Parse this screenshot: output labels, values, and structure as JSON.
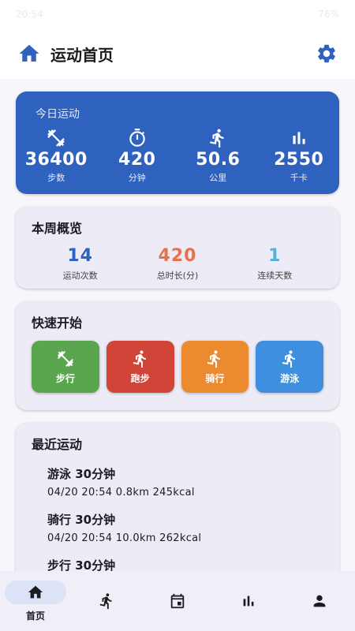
{
  "status_bar": {
    "time": "20:54",
    "battery": "76%"
  },
  "app_bar": {
    "title": "运动首页",
    "home_icon": "home-icon",
    "settings_icon": "gear-icon"
  },
  "today": {
    "label": "今日运动",
    "stats": [
      {
        "icon": "dumbbell-icon",
        "value": "36400",
        "unit": "步数"
      },
      {
        "icon": "timer-icon",
        "value": "420",
        "unit": "分钟"
      },
      {
        "icon": "run-icon",
        "value": "50.6",
        "unit": "公里"
      },
      {
        "icon": "bar-chart-icon",
        "value": "2550",
        "unit": "千卡"
      }
    ],
    "color": "#2f62bf"
  },
  "week": {
    "title": "本周概览",
    "stats": [
      {
        "value": "14",
        "caption": "运动次数",
        "color": "#2f62bf"
      },
      {
        "value": "420",
        "caption": "总时长(分)",
        "color": "#e7714c"
      },
      {
        "value": "1",
        "caption": "连续天数",
        "color": "#4fb5d8"
      }
    ]
  },
  "quick": {
    "title": "快速开始",
    "buttons": [
      {
        "label": "步行",
        "icon": "dumbbell-icon",
        "color": "#5aa64f"
      },
      {
        "label": "跑步",
        "icon": "run-icon",
        "color": "#d14438"
      },
      {
        "label": "骑行",
        "icon": "run-icon",
        "color": "#ec8a30"
      },
      {
        "label": "游泳",
        "icon": "run-icon",
        "color": "#3f8fe0"
      }
    ]
  },
  "recent": {
    "title": "最近运动",
    "items": [
      {
        "title": "游泳  30分钟",
        "detail": "04/20 20:54  0.8km  245kcal"
      },
      {
        "title": "骑行  30分钟",
        "detail": "04/20 20:54  10.0km  262kcal"
      },
      {
        "title": "步行  30分钟",
        "detail": ""
      }
    ]
  },
  "nav": {
    "items": [
      {
        "label": "首页",
        "icon": "home-icon",
        "active": true
      },
      {
        "label": "",
        "icon": "run-icon"
      },
      {
        "label": "",
        "icon": "calendar-icon"
      },
      {
        "label": "",
        "icon": "bar-chart-icon"
      },
      {
        "label": "",
        "icon": "person-icon"
      }
    ]
  }
}
